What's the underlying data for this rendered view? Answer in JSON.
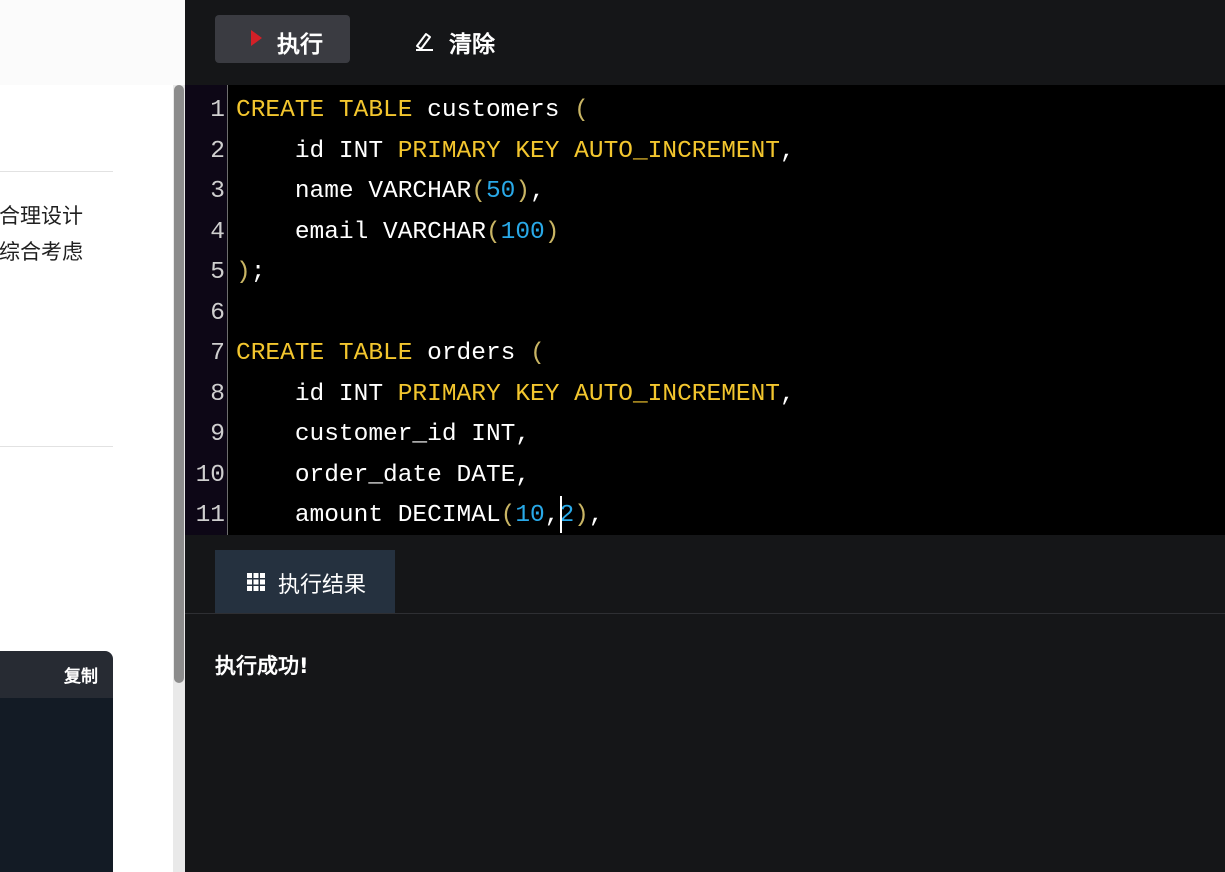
{
  "article": {
    "text_line_1": "合理设计",
    "text_line_2": "综合考虑",
    "code_card": {
      "copy_label": "复制"
    }
  },
  "toolbar": {
    "run_label": "执行",
    "run_icon": "play-icon",
    "clear_label": "清除",
    "clear_icon": "eraser-icon"
  },
  "editor": {
    "line_numbers": [
      "1",
      "2",
      "3",
      "4",
      "5",
      "6",
      "7",
      "8",
      "9",
      "10",
      "11"
    ],
    "code_lines": [
      "CREATE TABLE customers (",
      "    id INT PRIMARY KEY AUTO_INCREMENT,",
      "    name VARCHAR(50),",
      "    email VARCHAR(100)",
      ");",
      "",
      "CREATE TABLE orders (",
      "    id INT PRIMARY KEY AUTO_INCREMENT,",
      "    customer_id INT,",
      "    order_date DATE,",
      "    amount DECIMAL(10,2),"
    ],
    "colors": {
      "keyword": "#f3c62e",
      "number": "#29a9e8",
      "paren": "#c9b564",
      "identifier": "#ffffff"
    }
  },
  "results": {
    "tab_label": "执行结果",
    "tab_icon": "grid-icon",
    "message": "执行成功!"
  },
  "theme": {
    "editor_bg": "#000000",
    "panel_bg": "#151618",
    "run_accent": "#d32027",
    "tab_active_bg": "#25313f"
  }
}
